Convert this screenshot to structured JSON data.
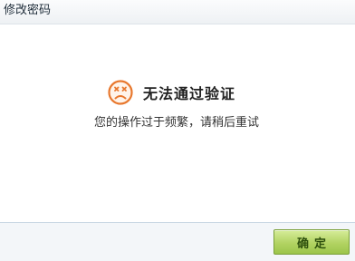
{
  "window": {
    "title": "修改密码"
  },
  "message": {
    "headline": "无法通过验证",
    "detail": "您的操作过于频繁，请稍后重试",
    "icon": "sad-face-icon"
  },
  "footer": {
    "confirm_label": "确定"
  },
  "colors": {
    "icon_orange": "#e8782e",
    "button_green": "#b2d363",
    "footer_border": "#c9d7e4"
  }
}
